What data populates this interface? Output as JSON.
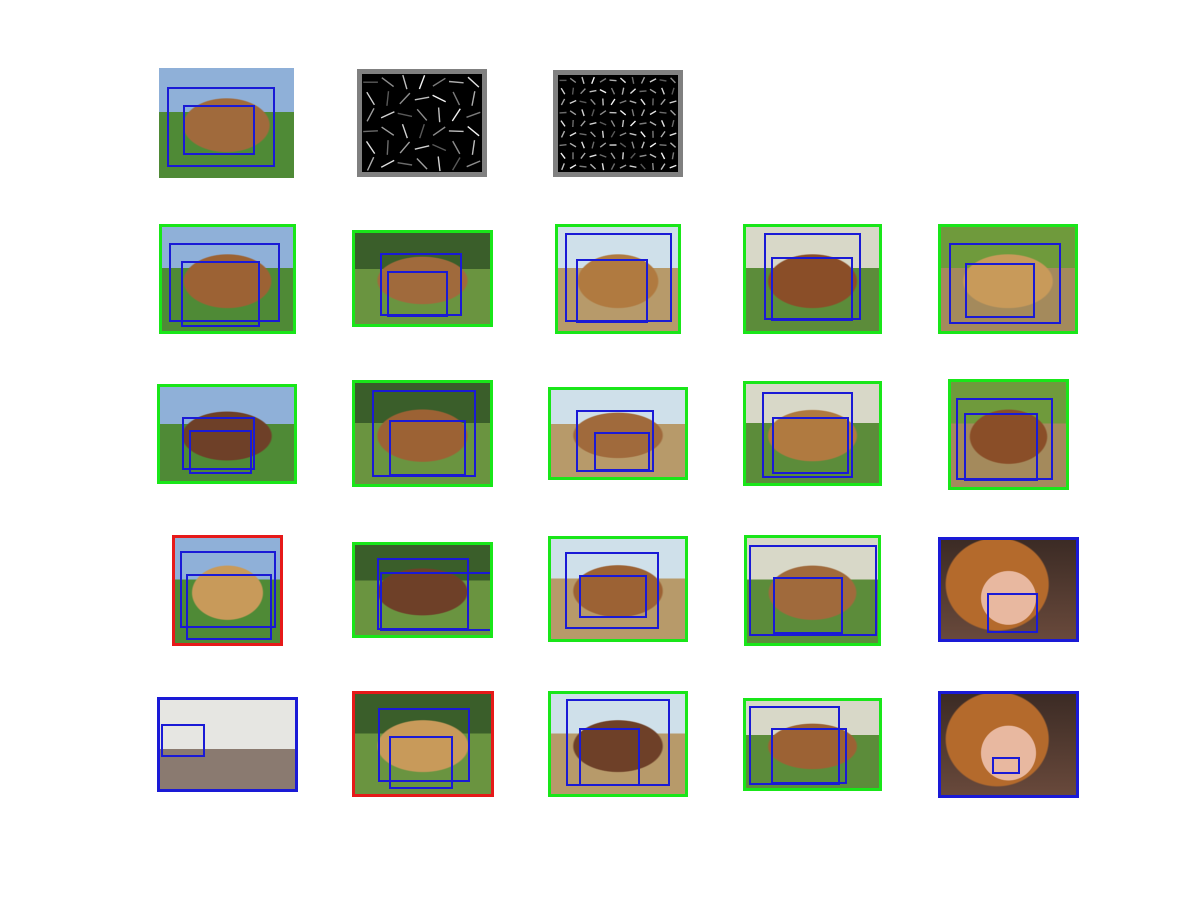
{
  "figure": {
    "colors": {
      "background": "#ffffff",
      "box": "#1a1ad6",
      "correct": "#19e619",
      "wrong": "#e61919",
      "other": "#1a1ad6",
      "hog_border": "#808080",
      "hog_background": "#000000",
      "hog_strokes": "#ffffff"
    },
    "rows": [
      {
        "tiles": [
          {
            "kind": "photo",
            "subject": "horse",
            "label": "none"
          },
          {
            "kind": "hog-root"
          },
          {
            "kind": "hog-parts"
          }
        ]
      },
      {
        "tiles": [
          {
            "kind": "photo",
            "subject": "horse",
            "label": "correct"
          },
          {
            "kind": "photo",
            "subject": "horse",
            "label": "correct"
          },
          {
            "kind": "photo",
            "subject": "horse",
            "label": "correct"
          },
          {
            "kind": "photo",
            "subject": "horse",
            "label": "correct"
          },
          {
            "kind": "photo",
            "subject": "horse",
            "label": "correct"
          }
        ]
      },
      {
        "tiles": [
          {
            "kind": "photo",
            "subject": "horse",
            "label": "correct"
          },
          {
            "kind": "photo",
            "subject": "horse",
            "label": "correct"
          },
          {
            "kind": "photo",
            "subject": "horse",
            "label": "correct"
          },
          {
            "kind": "photo",
            "subject": "horse",
            "label": "correct"
          },
          {
            "kind": "photo",
            "subject": "horse",
            "label": "correct"
          }
        ]
      },
      {
        "tiles": [
          {
            "kind": "photo",
            "subject": "horse",
            "label": "wrong"
          },
          {
            "kind": "photo",
            "subject": "horse",
            "label": "correct"
          },
          {
            "kind": "photo",
            "subject": "horse",
            "label": "correct"
          },
          {
            "kind": "photo",
            "subject": "horse",
            "label": "correct"
          },
          {
            "kind": "photo",
            "subject": "face",
            "label": "other"
          }
        ]
      },
      {
        "tiles": [
          {
            "kind": "photo",
            "subject": "room",
            "label": "other"
          },
          {
            "kind": "photo",
            "subject": "horse",
            "label": "wrong"
          },
          {
            "kind": "photo",
            "subject": "horse",
            "label": "correct"
          },
          {
            "kind": "photo",
            "subject": "horse",
            "label": "correct"
          },
          {
            "kind": "photo",
            "subject": "face",
            "label": "other"
          }
        ]
      }
    ]
  }
}
